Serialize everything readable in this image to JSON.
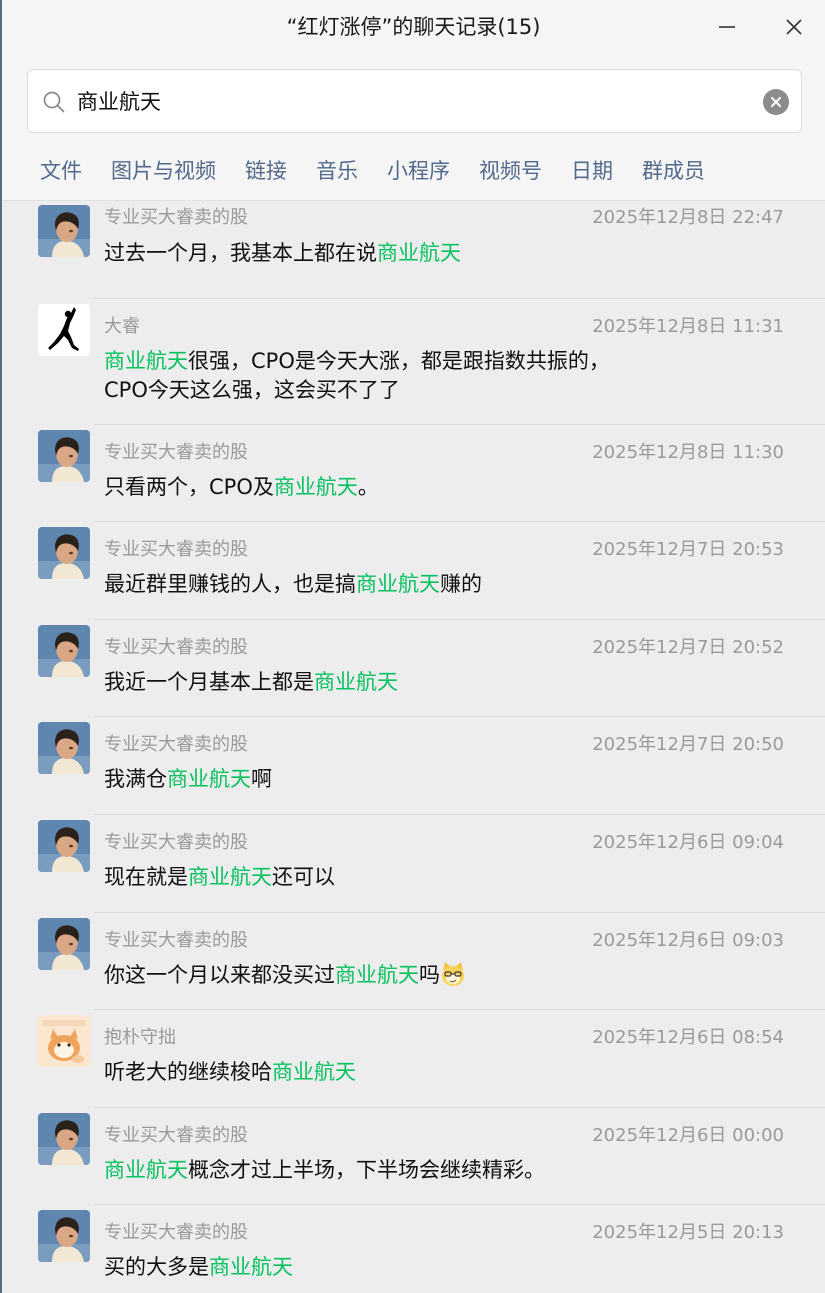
{
  "window": {
    "title": "“红灯涨停”的聊天记录(15)"
  },
  "search": {
    "value": "商业航天"
  },
  "filters": [
    "文件",
    "图片与视频",
    "链接",
    "音乐",
    "小程序",
    "视频号",
    "日期",
    "群成员"
  ],
  "colors": {
    "highlight": "#07c160",
    "filter_tab": "#536a8c",
    "meta_text": "#9a9a9a"
  },
  "results": [
    {
      "sender": "专业买大睿卖的股",
      "avatar": "portrait-avatar",
      "time": "2025年12月8日 22:47",
      "segments": [
        {
          "text": "过去一个月，我基本上都在说",
          "hl": false
        },
        {
          "text": "商业航天",
          "hl": true
        }
      ]
    },
    {
      "sender": "大睿",
      "avatar": "jordan-jumpman-logo",
      "time": "2025年12月8日 11:31",
      "segments": [
        {
          "text": "商业航天",
          "hl": true
        },
        {
          "text": "很强，CPO是今天大涨，都是跟指数共振的，\nCPO今天这么强，这会买不了了",
          "hl": false
        }
      ]
    },
    {
      "sender": "专业买大睿卖的股",
      "avatar": "portrait-avatar",
      "time": "2025年12月8日 11:30",
      "segments": [
        {
          "text": "只看两个，CPO及",
          "hl": false
        },
        {
          "text": "商业航天",
          "hl": true
        },
        {
          "text": "。",
          "hl": false
        }
      ]
    },
    {
      "sender": "专业买大睿卖的股",
      "avatar": "portrait-avatar",
      "time": "2025年12月7日 20:53",
      "segments": [
        {
          "text": "最近群里赚钱的人，也是搞",
          "hl": false
        },
        {
          "text": "商业航天",
          "hl": true
        },
        {
          "text": "赚的",
          "hl": false
        }
      ]
    },
    {
      "sender": "专业买大睿卖的股",
      "avatar": "portrait-avatar",
      "time": "2025年12月7日 20:52",
      "segments": [
        {
          "text": "我近一个月基本上都是",
          "hl": false
        },
        {
          "text": "商业航天",
          "hl": true
        }
      ]
    },
    {
      "sender": "专业买大睿卖的股",
      "avatar": "portrait-avatar",
      "time": "2025年12月7日 20:50",
      "segments": [
        {
          "text": "我满仓",
          "hl": false
        },
        {
          "text": "商业航天",
          "hl": true
        },
        {
          "text": "啊",
          "hl": false
        }
      ]
    },
    {
      "sender": "专业买大睿卖的股",
      "avatar": "portrait-avatar",
      "time": "2025年12月6日 09:04",
      "segments": [
        {
          "text": "现在就是",
          "hl": false
        },
        {
          "text": "商业航天",
          "hl": true
        },
        {
          "text": "还可以",
          "hl": false
        }
      ]
    },
    {
      "sender": "专业买大睿卖的股",
      "avatar": "portrait-avatar",
      "time": "2025年12月6日 09:03",
      "segments": [
        {
          "text": "你这一个月以来都没买过",
          "hl": false
        },
        {
          "text": "商业航天",
          "hl": true
        },
        {
          "text": "吗",
          "hl": false
        }
      ],
      "emoji": "smirk-cat-emoji"
    },
    {
      "sender": "抱朴守拙",
      "avatar": "cartoon-cat-avatar",
      "time": "2025年12月6日 08:54",
      "segments": [
        {
          "text": "听老大的继续梭哈",
          "hl": false
        },
        {
          "text": "商业航天",
          "hl": true
        }
      ]
    },
    {
      "sender": "专业买大睿卖的股",
      "avatar": "portrait-avatar",
      "time": "2025年12月6日 00:00",
      "segments": [
        {
          "text": "商业航天",
          "hl": true
        },
        {
          "text": "概念才过上半场，下半场会继续精彩。",
          "hl": false
        }
      ]
    },
    {
      "sender": "专业买大睿卖的股",
      "avatar": "portrait-avatar",
      "time": "2025年12月5日 20:13",
      "segments": [
        {
          "text": "买的大多是",
          "hl": false
        },
        {
          "text": "商业航天",
          "hl": true
        }
      ]
    }
  ]
}
